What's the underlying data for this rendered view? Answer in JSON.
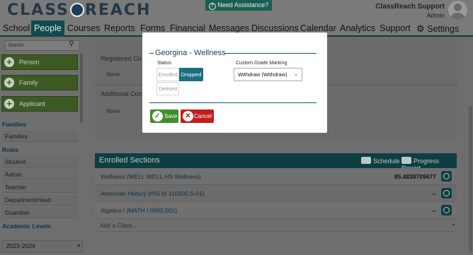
{
  "header": {
    "logo_left": "CLASS",
    "logo_right": "REACH",
    "assist_label": "Need Assistance?",
    "user_name": "ClassReach Support",
    "user_role": "Admin"
  },
  "nav": {
    "items": [
      "School",
      "People",
      "Courses",
      "Reports",
      "Forms",
      "Financial",
      "Messages",
      "Discussions",
      "Calendar",
      "Analytics",
      "Support",
      "Settings"
    ],
    "active": "People"
  },
  "sidebar": {
    "search_placeholder": "Search",
    "buttons": [
      "Person",
      "Family",
      "Applicant"
    ],
    "sections": [
      {
        "heading": "Families",
        "items": [
          "Families"
        ]
      },
      {
        "heading": "Roles",
        "items": [
          "Student",
          "Admin",
          "Teacher",
          "DepartmentHead",
          "Guardian"
        ]
      },
      {
        "heading": "Academic Levels",
        "items": []
      }
    ],
    "year_value": "2023-2024"
  },
  "main": {
    "registered_label": "Registered Co",
    "registered_value": "None",
    "additional_label": "Additional Con",
    "additional_value": "None",
    "enrolled": {
      "title": "Enrolled Sections",
      "schedule_label": "Schedule",
      "progress_label": "Progress Report",
      "rows": [
        {
          "name": "Wellness (WELL WELL.HS Wellness)",
          "grade": "85.4838709677"
        },
        {
          "name": "American History (HIS III 110300.S-01)",
          "grade": "--"
        },
        {
          "name": "Algebra I (MATH I 0902.001)",
          "grade": "--"
        }
      ],
      "add_placeholder": "Add a Class..."
    }
  },
  "modal": {
    "title": "Georgina - Wellness",
    "status_label": "Status",
    "status_options": [
      "Enrolled",
      "Dropped",
      "Deleted"
    ],
    "status_selected": "Dropped",
    "grade_label": "Custom Grade Marking",
    "grade_value": "Withdraw (Withdraw)",
    "save_label": "Save",
    "cancel_label": "Cancel"
  },
  "colors": {
    "brand_teal": "#0f4a4d",
    "save_green": "#3e8f2a",
    "cancel_red": "#c41c1c",
    "toggle_active": "#1c6e7d"
  }
}
